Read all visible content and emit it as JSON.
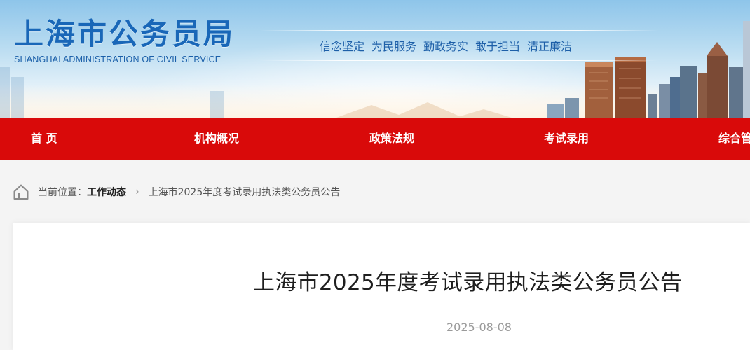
{
  "header": {
    "title": "上海市公务员局",
    "subtitle": "SHANGHAI ADMINISTRATION OF CIVIL SERVICE",
    "motto": [
      "信念坚定",
      "为民服务",
      "勤政务实",
      "敢于担当",
      "清正廉洁"
    ]
  },
  "nav": {
    "items": [
      {
        "label": "首 页"
      },
      {
        "label": "机构概况"
      },
      {
        "label": "政策法规"
      },
      {
        "label": "考试录用"
      },
      {
        "label": "综合管"
      }
    ]
  },
  "breadcrumb": {
    "prefix": "当前位置：",
    "section": "工作动态",
    "separator": "›",
    "page": "上海市2025年度考试录用执法类公务员公告",
    "icon": "home-icon"
  },
  "article": {
    "title": "上海市2025年度考试录用执法类公务员公告",
    "date": "2025-08-08"
  },
  "colors": {
    "brand_blue": "#1967b8",
    "nav_red": "#d90a0a",
    "page_bg": "#f4f4f4"
  }
}
